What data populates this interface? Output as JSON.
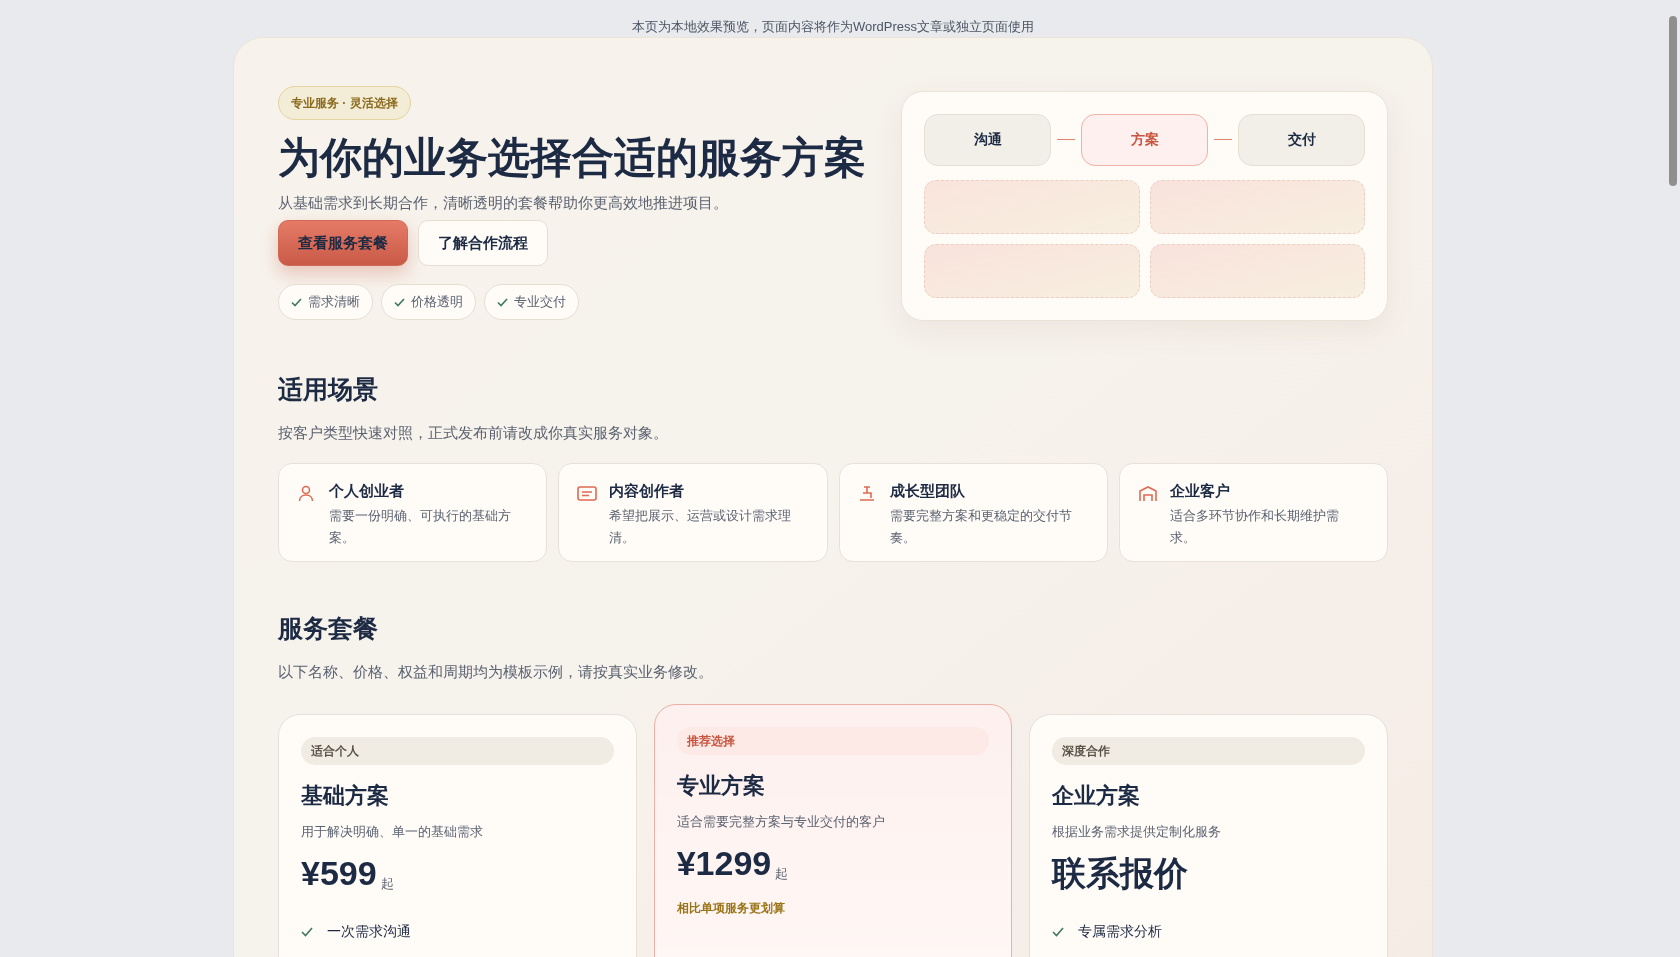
{
  "notice": "本页为本地效果预览，页面内容将作为WordPress文章或独立页面使用",
  "hero": {
    "badge": "专业服务 · 灵活选择",
    "title": "为你的业务选择合适的服务方案",
    "subtitle": "从基础需求到长期合作，清晰透明的套餐帮助你更高效地推进项目。",
    "buttons": [
      {
        "label": "查看服务套餐",
        "kind": "primary"
      },
      {
        "label": "了解合作流程",
        "kind": "secondary"
      }
    ],
    "chips": [
      "需求清晰",
      "价格透明",
      "专业交付"
    ],
    "steps": [
      {
        "label": "沟通",
        "selected": false
      },
      {
        "label": "方案",
        "selected": true
      },
      {
        "label": "交付",
        "selected": false
      }
    ]
  },
  "scenarios": {
    "title": "适用场景",
    "subtitle": "按客户类型快速对照，正式发布前请改成你真实服务对象。",
    "items": [
      {
        "kind": "person",
        "title": "个人创业者",
        "text": "需要一份明确、可执行的基础方案。"
      },
      {
        "kind": "content",
        "title": "内容创作者",
        "text": "希望把展示、运营或设计需求理清。"
      },
      {
        "kind": "team",
        "title": "成长型团队",
        "text": "需要完整方案和更稳定的交付节奏。"
      },
      {
        "kind": "enterprise",
        "title": "企业客户",
        "text": "适合多环节协作和长期维护需求。"
      }
    ]
  },
  "plans": {
    "title": "服务套餐",
    "subtitle": "以下名称、价格、权益和周期均为模板示例，请按真实业务修改。",
    "items": [
      {
        "tag": "适合个人",
        "name": "基础方案",
        "desc": "用于解决明确、单一的基础需求",
        "price": "¥599",
        "unit": "起",
        "selected": false,
        "features": [
          "一次需求沟通"
        ]
      },
      {
        "tag": "推荐选择",
        "name": "专业方案",
        "desc": "适合需要完整方案与专业交付的客户",
        "price": "¥1299",
        "unit": "起",
        "note": "相比单项服务更划算",
        "selected": true
      },
      {
        "tag": "深度合作",
        "name": "企业方案",
        "desc": "根据业务需求提供定制化服务",
        "price": "联系报价",
        "selected": false,
        "features": [
          "专属需求分析"
        ]
      }
    ]
  }
}
